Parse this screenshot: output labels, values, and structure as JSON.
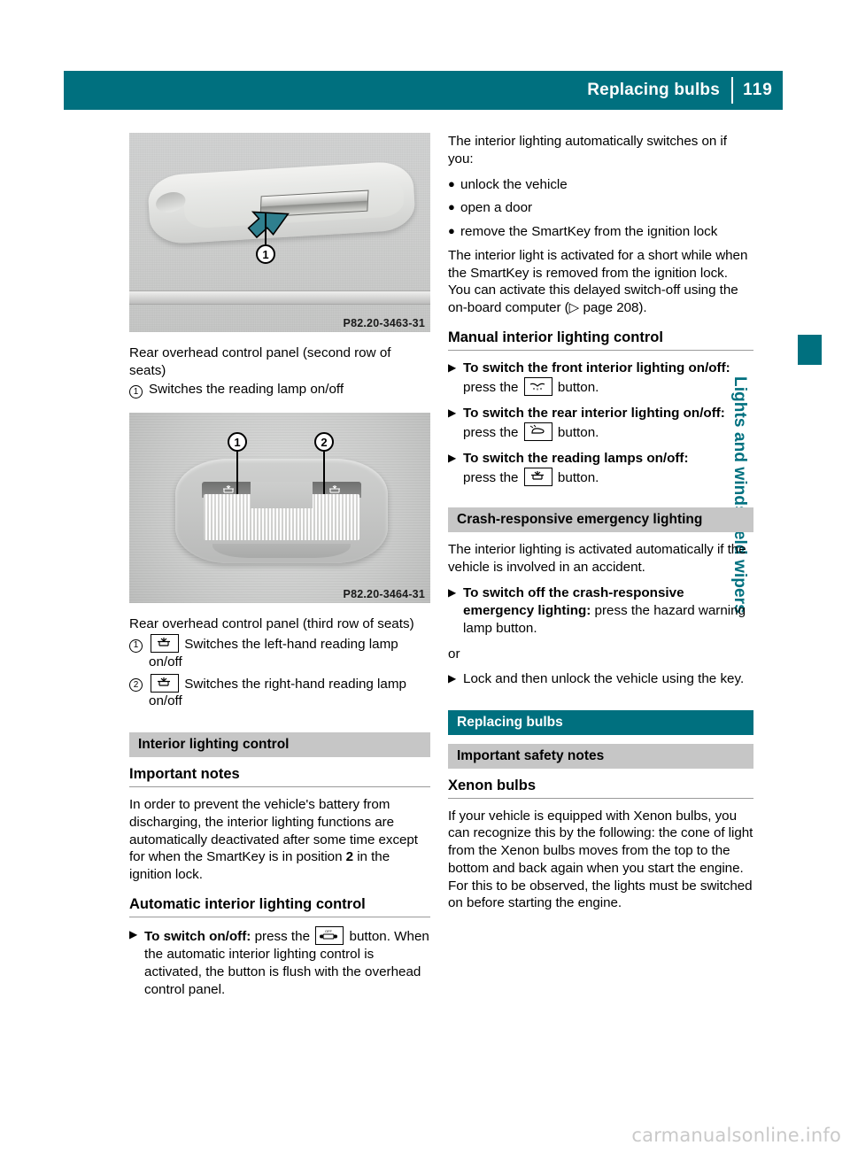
{
  "header": {
    "title": "Replacing bulbs",
    "page_number": "119"
  },
  "side_tab": {
    "label": "Lights and windshield wipers",
    "color": "#00707f"
  },
  "left_column": {
    "figure1": {
      "code": "P82.20-3463-31",
      "caption": "Rear overhead control panel (second row of seats)",
      "callout": "1"
    },
    "figure1_items": [
      {
        "num": "1",
        "text": "Switches the reading lamp on/off"
      }
    ],
    "figure2": {
      "code": "P82.20-3464-31",
      "caption": "Rear overhead control panel (third row of seats)",
      "callouts": [
        "1",
        "2"
      ]
    },
    "figure2_items": [
      {
        "num": "1",
        "icon": "reading-lamp-icon",
        "text": "Switches the left-hand reading lamp on/off"
      },
      {
        "num": "2",
        "icon": "reading-lamp-icon",
        "text": "Switches the right-hand reading lamp on/off"
      }
    ],
    "section_interior_lighting_control": "Interior lighting control",
    "heading_important_notes": "Important notes",
    "important_notes_text_a": "In order to prevent the vehicle's battery from discharging, the interior lighting functions are automatically deactivated after some time except for when the SmartKey is in position ",
    "important_notes_position": "2",
    "important_notes_text_b": " in the ignition lock.",
    "heading_automatic": "Automatic interior lighting control",
    "automatic_step": {
      "bold": "To switch on/off:",
      "text_before": " press the ",
      "icon": "auto-interior-light-off-icon",
      "text_after": " button. When the automatic interior lighting control is activated, the button is flush with the overhead control panel."
    }
  },
  "right_column": {
    "intro": "The interior lighting automatically switches on if you:",
    "bullets": [
      "unlock the vehicle",
      "open a door",
      "remove the SmartKey from the ignition lock"
    ],
    "paragraph_delayed_a": "The interior light is activated for a short while when the SmartKey is removed from the ignition lock. You can activate this delayed switch-off using the on-board computer (",
    "paragraph_delayed_ref": "page 208",
    "paragraph_delayed_b": ").",
    "heading_manual": "Manual interior lighting control",
    "manual_steps": [
      {
        "bold": "To switch the front interior lighting on/off:",
        "text_before": " press the ",
        "icon": "front-interior-light-icon",
        "text_after": " button."
      },
      {
        "bold": "To switch the rear interior lighting on/off:",
        "text_before": " press the ",
        "icon": "rear-interior-light-icon",
        "text_after": " button."
      },
      {
        "bold": "To switch the reading lamps on/off:",
        "text_before": " press the ",
        "icon": "reading-lamp-icon",
        "text_after": " button."
      }
    ],
    "section_crash": "Crash-responsive emergency lighting",
    "crash_paragraph": "The interior lighting is activated automatically if the vehicle is involved in an accident.",
    "crash_step": {
      "bold": "To switch off the crash-responsive emergency lighting:",
      "text": " press the hazard warning lamp button."
    },
    "or_label": "or",
    "crash_step2": "Lock and then unlock the vehicle using the key.",
    "section_replacing_bulbs": "Replacing bulbs",
    "section_important_safety": "Important safety notes",
    "heading_xenon": "Xenon bulbs",
    "xenon_paragraph": "If your vehicle is equipped with Xenon bulbs, you can recognize this by the following: the cone of light from the Xenon bulbs moves from the top to the bottom and back again when you start the engine. For this to be observed, the lights must be switched on before starting the engine."
  },
  "watermark": "carmanualsonline.info"
}
